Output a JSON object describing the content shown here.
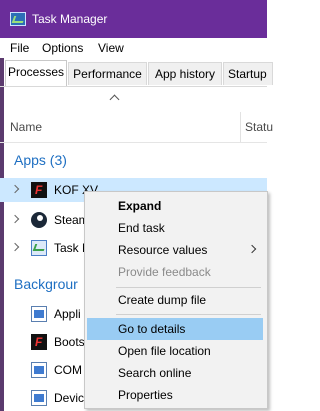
{
  "window": {
    "title": "Task Manager",
    "titlebar_color": "#6a2d9a"
  },
  "menubar": {
    "items": [
      "File",
      "Options",
      "View"
    ]
  },
  "tabs": [
    "Processes",
    "Performance",
    "App history",
    "Startup"
  ],
  "columns": {
    "name": "Name",
    "status": "Statu"
  },
  "groups": {
    "apps": "Apps (3)",
    "background": "Backgrour"
  },
  "apps": [
    {
      "label": "KOF XV",
      "icon": "kof-game-icon"
    },
    {
      "label": "Steam",
      "icon": "steam-icon"
    },
    {
      "label": "Task M",
      "icon": "task-manager-icon"
    }
  ],
  "background": [
    {
      "label": "Appli",
      "icon": "app-window-icon"
    },
    {
      "label": "Boots",
      "icon": "kof-game-icon"
    },
    {
      "label": "COM",
      "icon": "app-window-icon"
    },
    {
      "label": "Devic",
      "icon": "app-window-icon"
    }
  ],
  "context_menu": {
    "items": [
      {
        "label": "Expand",
        "bold": true
      },
      {
        "label": "End task"
      },
      {
        "label": "Resource values",
        "submenu": true
      },
      {
        "label": "Provide feedback",
        "disabled": true
      },
      {
        "separator": true
      },
      {
        "label": "Create dump file"
      },
      {
        "separator": true
      },
      {
        "label": "Go to details",
        "highlighted": true
      },
      {
        "label": "Open file location"
      },
      {
        "label": "Search online"
      },
      {
        "label": "Properties"
      }
    ],
    "highlight_color": "#99ccf3"
  }
}
